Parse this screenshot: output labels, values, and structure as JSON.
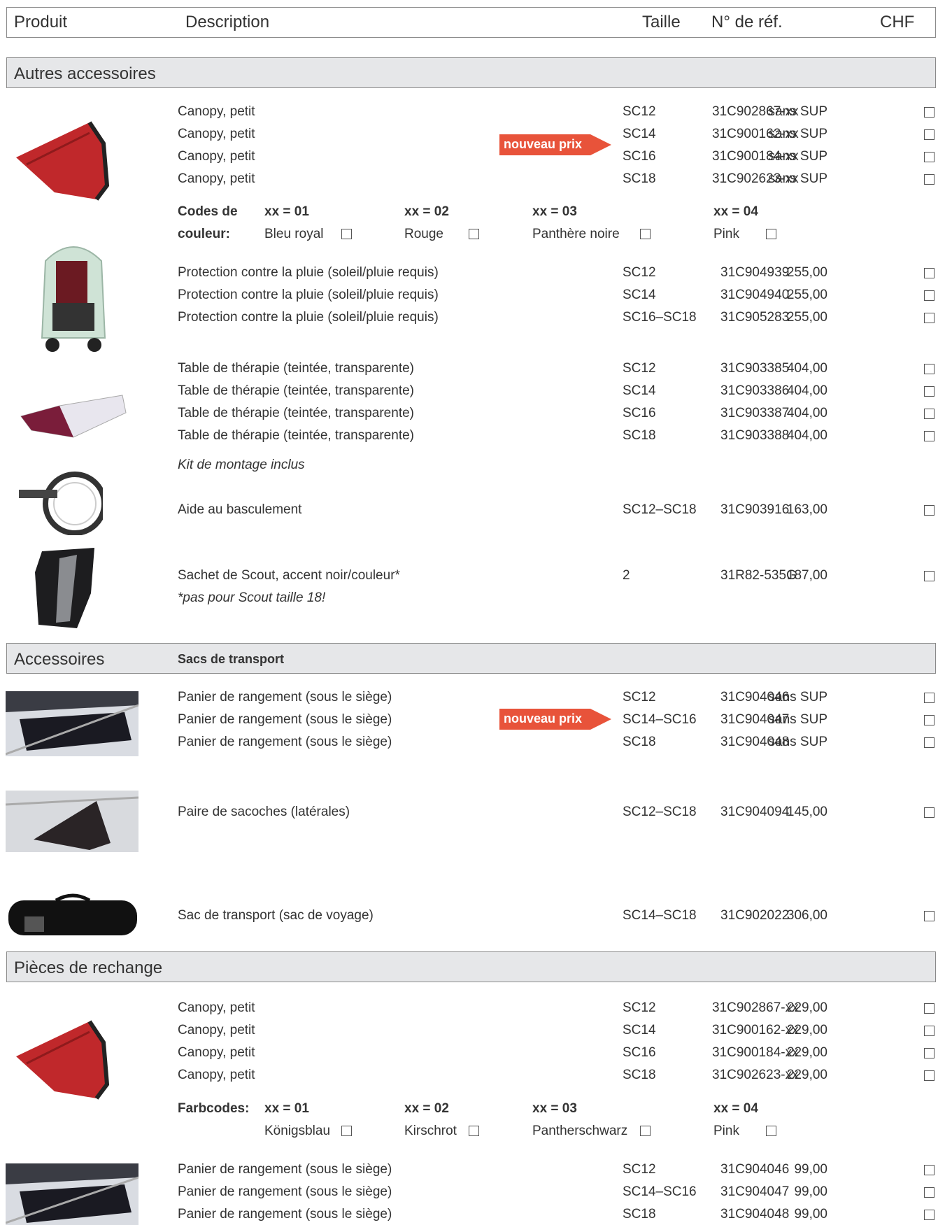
{
  "header": {
    "produit": "Produit",
    "description": "Description",
    "taille": "Taille",
    "ref": "N° de réf.",
    "chf": "CHF"
  },
  "sections": {
    "autres": "Autres accessoires",
    "accessoires": "Accessoires",
    "accessoires_sub": "Sacs de transport",
    "pieces": "Pièces de rechange"
  },
  "badge_text": "nouveau prix",
  "colors": {
    "badge": "#e8533a",
    "section_bg": "#e6e7e9",
    "border": "#8a8a8a"
  },
  "autres_rows": [
    {
      "desc": "Canopy, petit",
      "size": "SC12",
      "ref": "31C902867-xx",
      "price": "sans SUP"
    },
    {
      "desc": "Canopy, petit",
      "size": "SC14",
      "ref": "31C900162-xx",
      "price": "sans SUP"
    },
    {
      "desc": "Canopy, petit",
      "size": "SC16",
      "ref": "31C900184-xx",
      "price": "sans SUP"
    },
    {
      "desc": "Canopy, petit",
      "size": "SC18",
      "ref": "31C902623-xx",
      "price": "sans SUP"
    },
    {
      "desc": "Protection contre la pluie (soleil/pluie requis)",
      "size": "SC12",
      "ref": "31C904939",
      "price": "255,00"
    },
    {
      "desc": "Protection contre la pluie (soleil/pluie requis)",
      "size": "SC14",
      "ref": "31C904940",
      "price": "255,00"
    },
    {
      "desc": "Protection contre la pluie (soleil/pluie requis)",
      "size": "SC16–SC18",
      "ref": "31C905283",
      "price": "255,00"
    },
    {
      "desc": "Table de thérapie (teintée, transparente)",
      "size": "SC12",
      "ref": "31C903385",
      "price": "404,00"
    },
    {
      "desc": "Table de thérapie (teintée, transparente)",
      "size": "SC14",
      "ref": "31C903386",
      "price": "404,00"
    },
    {
      "desc": "Table de thérapie (teintée, transparente)",
      "size": "SC16",
      "ref": "31C903387",
      "price": "404,00"
    },
    {
      "desc": "Table de thérapie (teintée, transparente)",
      "size": "SC18",
      "ref": "31C903388",
      "price": "404,00"
    },
    {
      "desc": "Aide au basculement",
      "size": "SC12–SC18",
      "ref": "31C903916",
      "price": "163,00"
    },
    {
      "desc": "Sachet de Scout, accent noir/couleur*",
      "size": "2",
      "ref": "31R82-535G",
      "price": "187,00"
    }
  ],
  "notes": {
    "kit": "Kit de montage inclus",
    "scout": "*pas pour Scout taille 18!"
  },
  "colorcodes_fr": {
    "label1": "Codes de",
    "label2": "couleur:",
    "items": [
      {
        "code": "xx = 01",
        "name": "Bleu royal"
      },
      {
        "code": "xx = 02",
        "name": "Rouge"
      },
      {
        "code": "xx = 03",
        "name": "Panthère noire"
      },
      {
        "code": "xx = 04",
        "name": "Pink"
      }
    ]
  },
  "accessoires_rows": [
    {
      "desc": "Panier de rangement (sous le siège)",
      "size": "SC12",
      "ref": "31C904046",
      "price": "sans SUP"
    },
    {
      "desc": "Panier de rangement (sous le siège)",
      "size": "SC14–SC16",
      "ref": "31C904047",
      "price": "sans SUP"
    },
    {
      "desc": "Panier de rangement (sous le siège)",
      "size": "SC18",
      "ref": "31C904048",
      "price": "sans SUP"
    },
    {
      "desc": "Paire de sacoches (latérales)",
      "size": "SC12–SC18",
      "ref": "31C904094",
      "price": "145,00"
    },
    {
      "desc": "Sac de transport (sac de voyage)",
      "size": "SC14–SC18",
      "ref": "31C902022",
      "price": "306,00"
    }
  ],
  "pieces_rows": [
    {
      "desc": "Canopy, petit",
      "size": "SC12",
      "ref": "31C902867-xx",
      "price": "229,00"
    },
    {
      "desc": "Canopy, petit",
      "size": "SC14",
      "ref": "31C900162-xx",
      "price": "229,00"
    },
    {
      "desc": "Canopy, petit",
      "size": "SC16",
      "ref": "31C900184-xx",
      "price": "229,00"
    },
    {
      "desc": "Canopy, petit",
      "size": "SC18",
      "ref": "31C902623-xx",
      "price": "229,00"
    },
    {
      "desc": "Panier de rangement (sous le siège)",
      "size": "SC12",
      "ref": "31C904046",
      "price": "99,00"
    },
    {
      "desc": "Panier de rangement (sous le siège)",
      "size": "SC14–SC16",
      "ref": "31C904047",
      "price": "99,00"
    },
    {
      "desc": "Panier de rangement (sous le siège)",
      "size": "SC18",
      "ref": "31C904048",
      "price": "99,00"
    }
  ],
  "colorcodes_de": {
    "label": "Farbcodes:",
    "items": [
      {
        "code": "xx = 01",
        "name": "Königsblau"
      },
      {
        "code": "xx = 02",
        "name": "Kirschrot"
      },
      {
        "code": "xx = 03",
        "name": "Pantherschwarz"
      },
      {
        "code": "xx = 04",
        "name": "Pink"
      }
    ]
  }
}
